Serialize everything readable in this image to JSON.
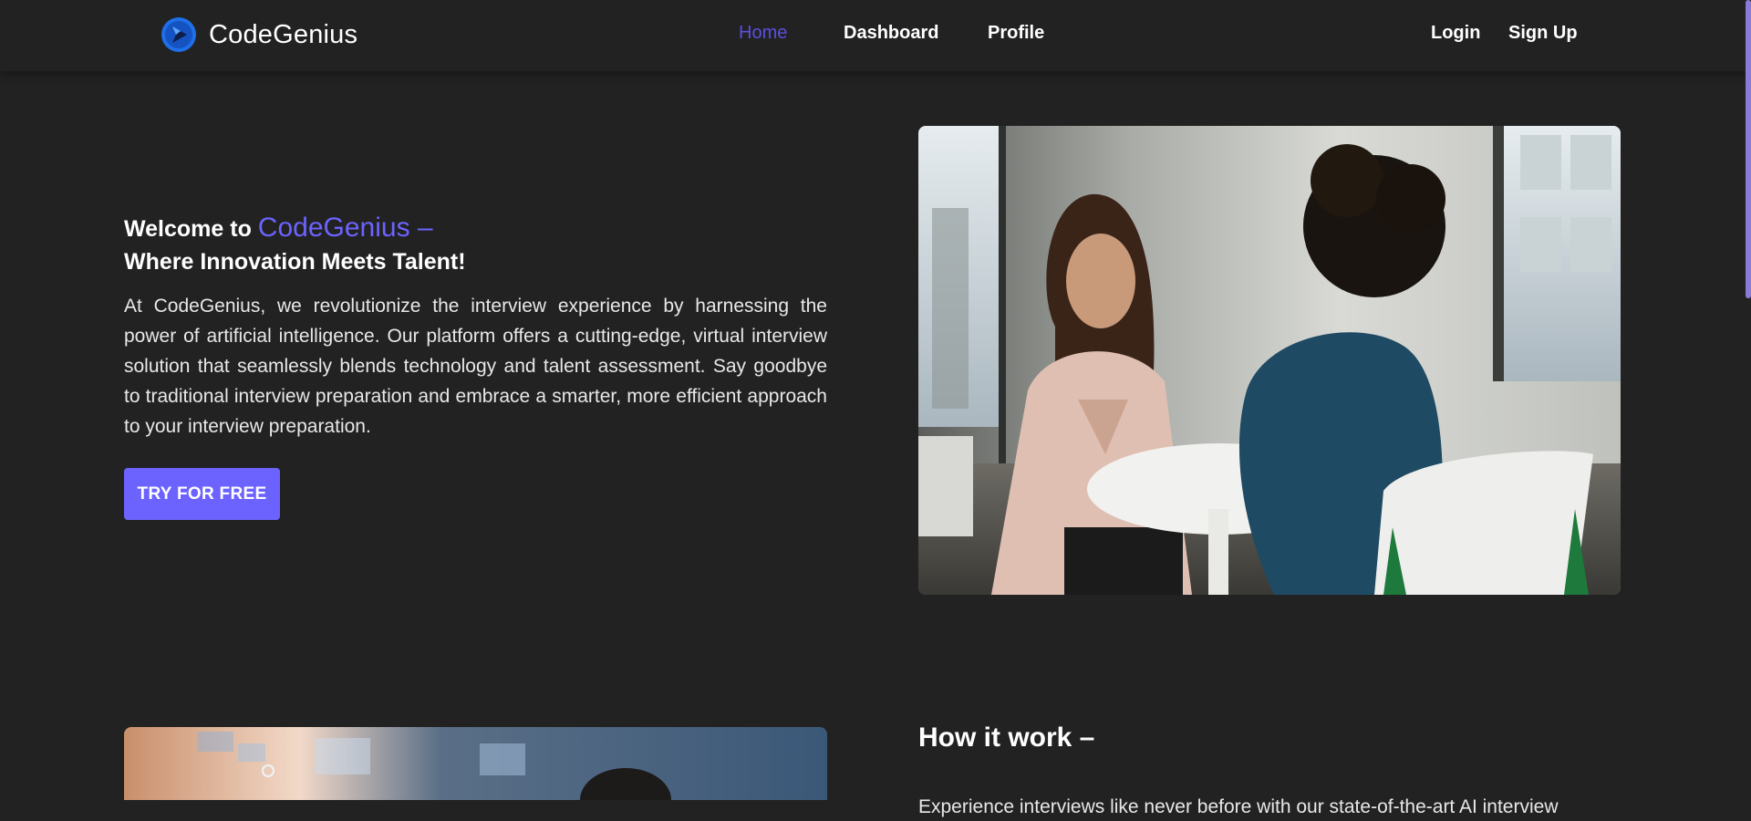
{
  "brand": {
    "name": "CodeGenius",
    "accent_color": "#6c63ff",
    "logo_icon": "codegenius-logo-icon"
  },
  "nav": {
    "home": "Home",
    "dashboard": "Dashboard",
    "profile": "Profile",
    "login": "Login",
    "signup": "Sign Up",
    "active": "Home"
  },
  "hero": {
    "title_prefix": "Welcome to ",
    "title_accent": "CodeGenius –",
    "subtitle": "Where Innovation Meets Talent!",
    "body": "At CodeGenius, we revolutionize the interview experience by harnessing the power of artificial intelligence. Our platform offers a cutting-edge, virtual interview solution that seamlessly blends technology and talent assessment. Say goodbye to traditional interview preparation and embrace a smarter, more efficient approach to your interview preparation.",
    "cta_label": "TRY FOR FREE"
  },
  "how": {
    "title": "How it work –",
    "body": "Experience interviews like never before with our state-of-the-art AI interview"
  }
}
